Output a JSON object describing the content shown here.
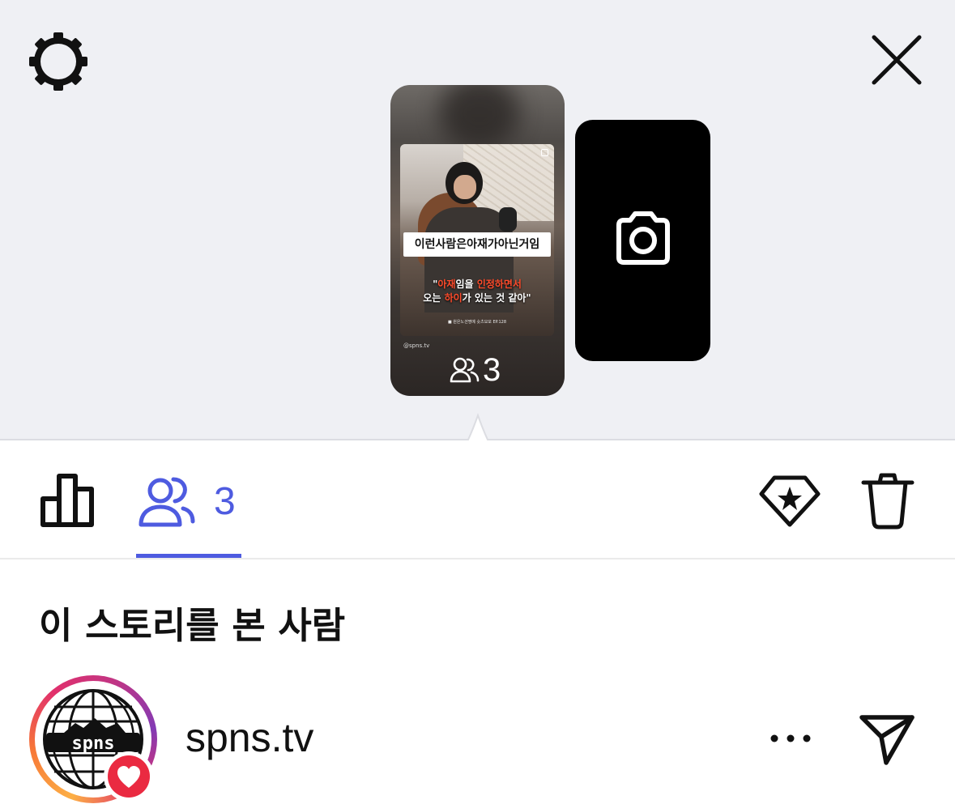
{
  "top_bar": {
    "settings_icon": "gear-icon",
    "close_icon": "close-icon"
  },
  "story": {
    "caption": "이런사람은아재가아닌거임",
    "quote_line1_a": "\"",
    "quote_line1_red1": "아재",
    "quote_line1_b": "임을 ",
    "quote_line1_red2": "인정하면서",
    "quote_line2_a": "오는 ",
    "quote_line2_red": "하이",
    "quote_line2_b": "가 있는 것 같아\"",
    "source": "■ 원은노션명예 숏츠모모 EP.128",
    "handle": "@spns.tv",
    "viewer_count": "3"
  },
  "camera_card": {
    "icon": "camera-icon"
  },
  "tabs": {
    "stats_icon": "bar-chart-icon",
    "viewers_icon": "people-icon",
    "viewers_count": "3",
    "active_color": "#4e5be0"
  },
  "actions": {
    "highlight_icon": "highlight-diamond-icon",
    "delete_icon": "trash-icon"
  },
  "viewers_section": {
    "title": "이 스토리를 본 사람",
    "viewers": [
      {
        "username": "spns.tv",
        "avatar_text": "spns",
        "reaction": "heart-icon",
        "more_icon": "more-icon",
        "send_icon": "send-icon"
      }
    ]
  },
  "colors": {
    "top_background": "#eff0f4",
    "accent": "#4e5be0",
    "heart": "#ea2a41"
  }
}
